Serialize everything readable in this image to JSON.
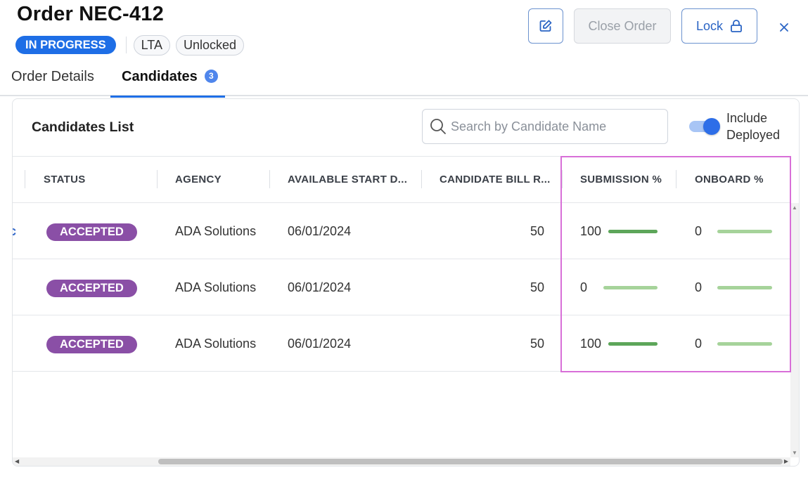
{
  "order": {
    "title": "Order NEC-412",
    "status_badge": "IN PROGRESS",
    "chips": [
      "LTA",
      "Unlocked"
    ]
  },
  "header_actions": {
    "edit_icon": "edit-icon",
    "close_order_label": "Close Order",
    "lock_label": "Lock",
    "lock_icon": "lock-icon",
    "close_icon": "close-icon"
  },
  "tabs": [
    {
      "label": "Order Details",
      "active": false
    },
    {
      "label": "Candidates",
      "active": true,
      "count": "3"
    }
  ],
  "candidates": {
    "title": "Candidates List",
    "search_placeholder": "Search by Candidate Name",
    "search_icon": "search-icon",
    "toggle_label_line1": "Include",
    "toggle_label_line2": "Deployed",
    "toggle_on": true,
    "columns": [
      "STATUS",
      "AGENCY",
      "AVAILABLE START D...",
      "CANDIDATE BILL R...",
      "SUBMISSION %",
      "ONBOARD %"
    ],
    "truncated_first_col_text": "tuc",
    "rows": [
      {
        "status": "ACCEPTED",
        "agency": "ADA Solutions",
        "start_date": "06/01/2024",
        "bill_rate": "50",
        "submission": "100",
        "submission_fraction": 1.0,
        "onboard": "0",
        "onboard_fraction": 0.0
      },
      {
        "status": "ACCEPTED",
        "agency": "ADA Solutions",
        "start_date": "06/01/2024",
        "bill_rate": "50",
        "submission": "0",
        "submission_fraction": 0.0,
        "onboard": "0",
        "onboard_fraction": 0.0
      },
      {
        "status": "ACCEPTED",
        "agency": "ADA Solutions",
        "start_date": "06/01/2024",
        "bill_rate": "50",
        "submission": "100",
        "submission_fraction": 1.0,
        "onboard": "0",
        "onboard_fraction": 0.0
      }
    ]
  },
  "colors": {
    "accent": "#1e6ee6",
    "status_pill": "#8a4fa6",
    "bar_track": "#a6d39a",
    "bar_fill": "#5da65a",
    "highlight": "#d86fd8"
  }
}
